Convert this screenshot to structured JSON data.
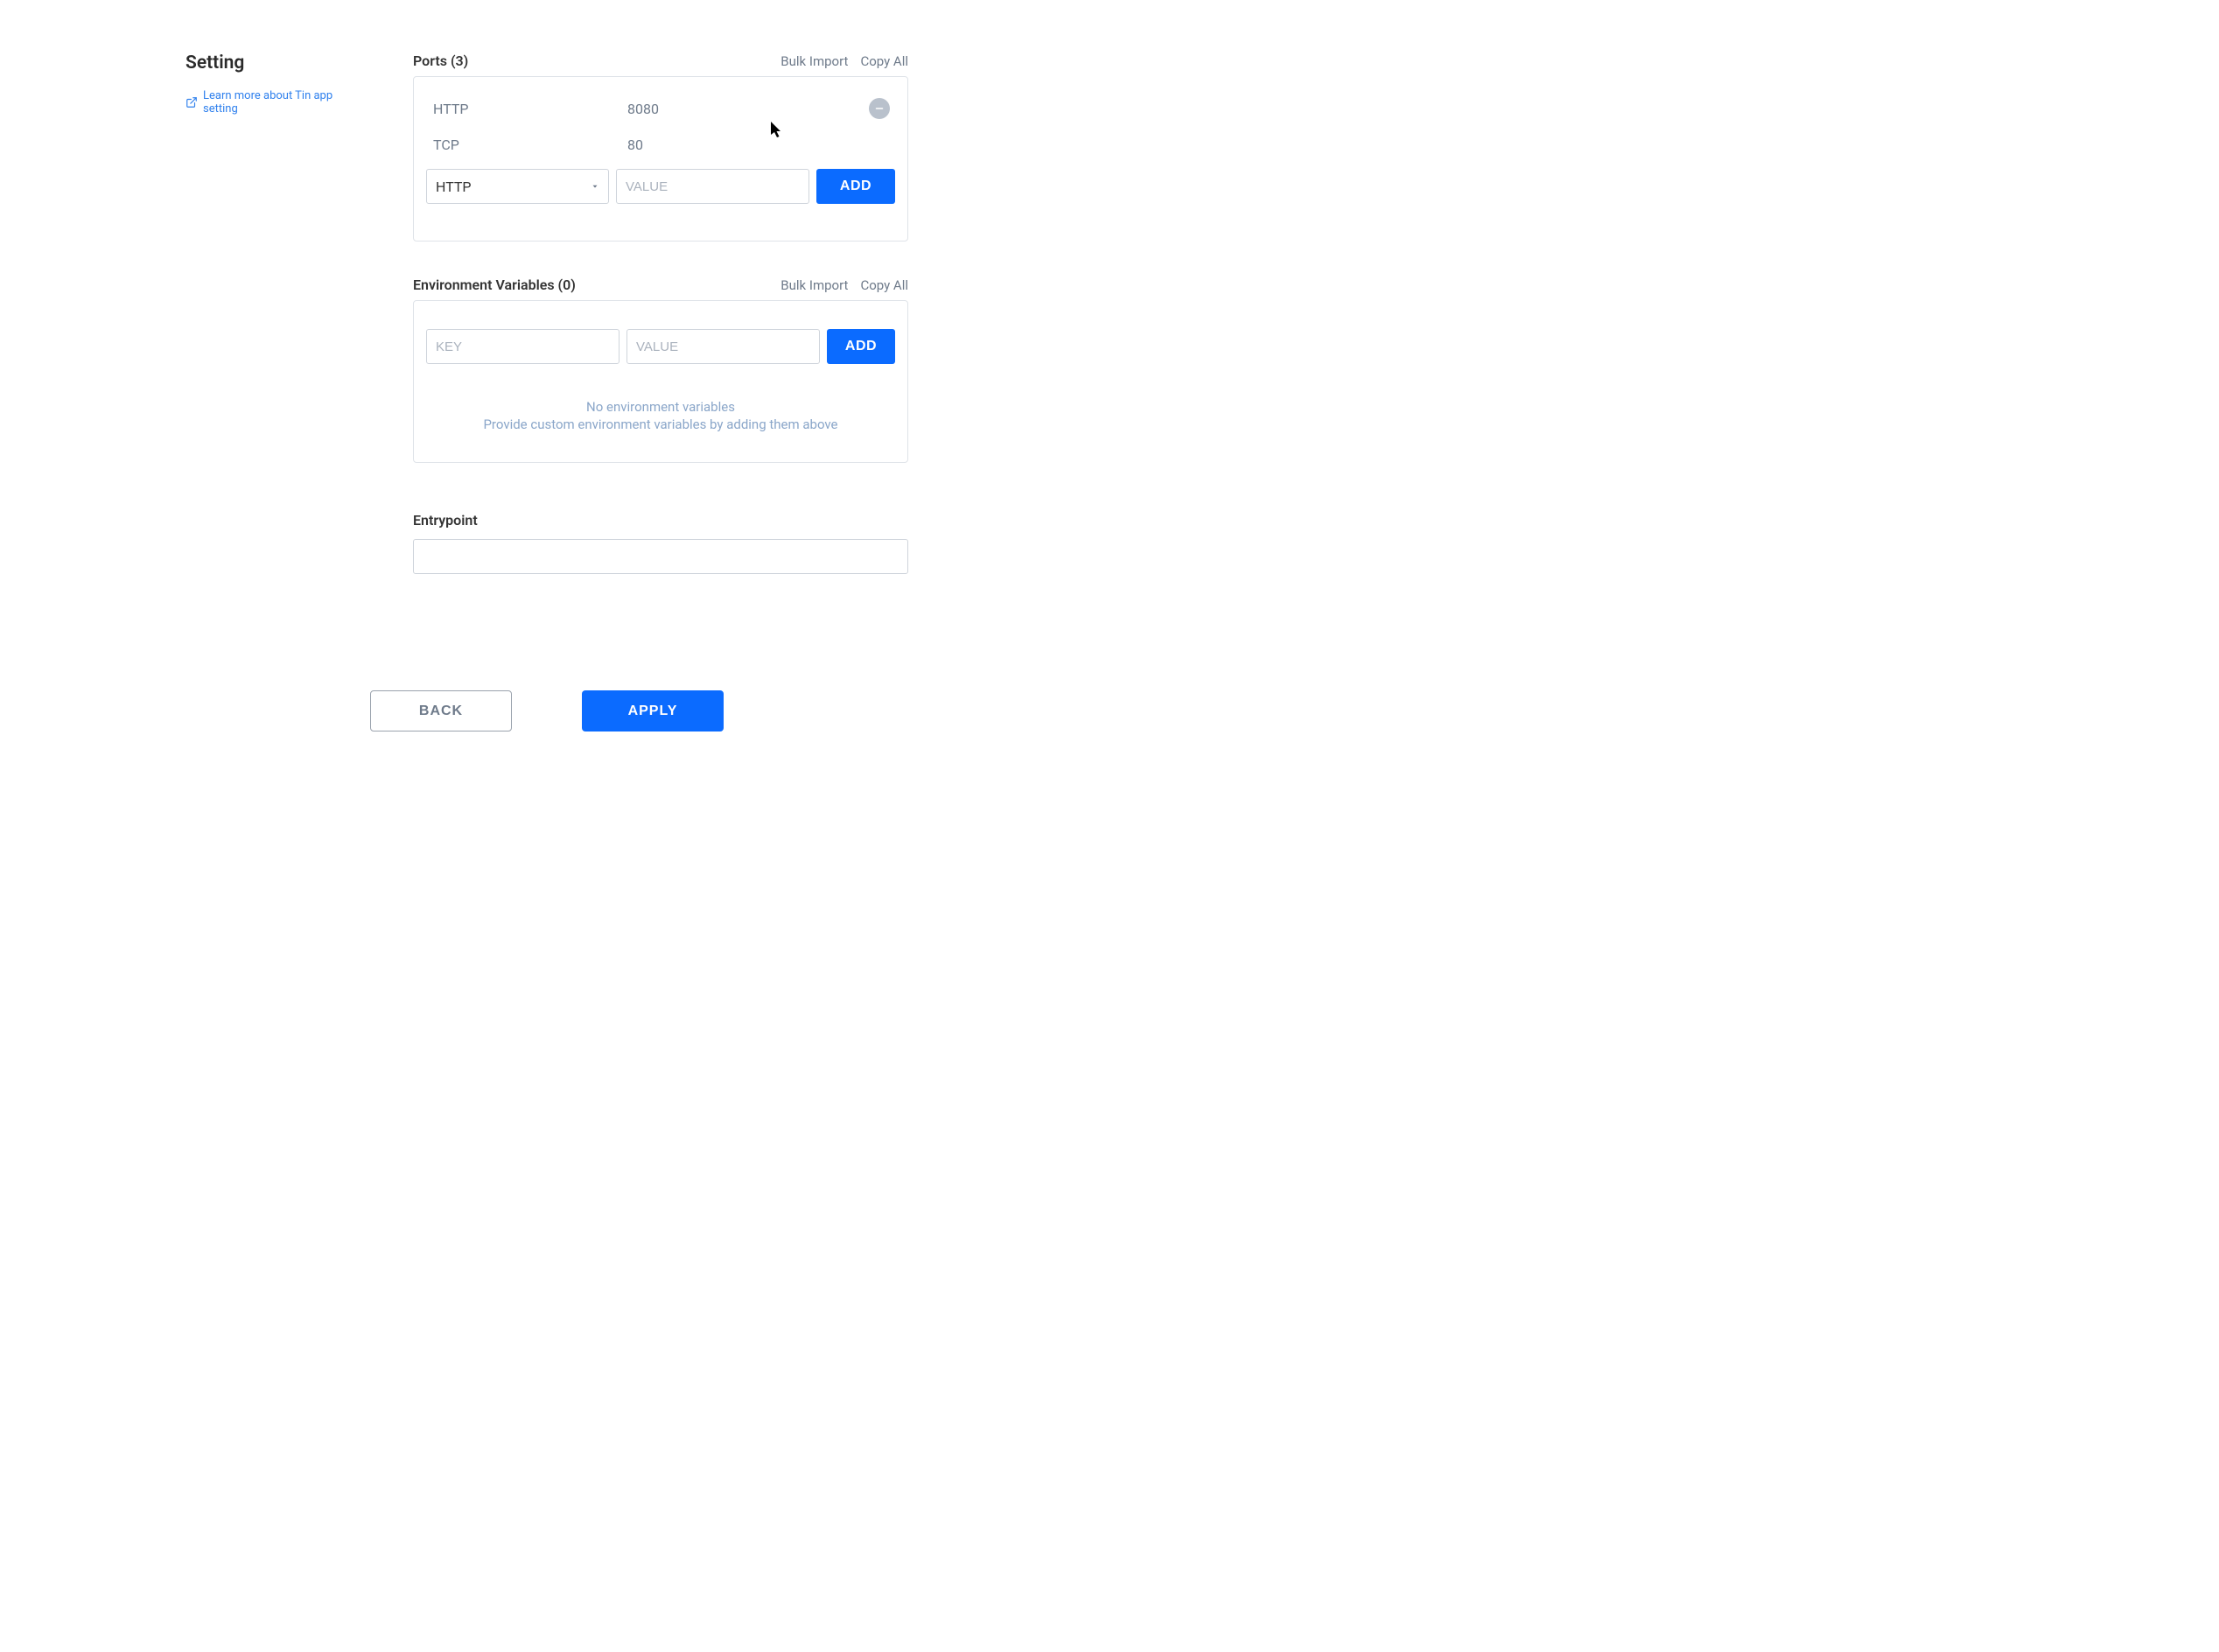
{
  "sidebar": {
    "title": "Setting",
    "learn_more": "Learn more about Tin app setting"
  },
  "ports": {
    "title": "Ports (3)",
    "bulk_import": "Bulk Import",
    "copy_all": "Copy All",
    "items": [
      {
        "type": "HTTP",
        "value": "8080"
      },
      {
        "type": "TCP",
        "value": "80"
      }
    ],
    "select_value": "HTTP",
    "value_placeholder": "VALUE",
    "add_label": "ADD"
  },
  "env": {
    "title": "Environment Variables (0)",
    "bulk_import": "Bulk Import",
    "copy_all": "Copy All",
    "key_placeholder": "KEY",
    "value_placeholder": "VALUE",
    "add_label": "ADD",
    "empty_title": "No environment variables",
    "empty_sub": "Provide custom environment variables by adding them above"
  },
  "entrypoint": {
    "title": "Entrypoint",
    "value": ""
  },
  "footer": {
    "back": "BACK",
    "apply": "APPLY"
  }
}
